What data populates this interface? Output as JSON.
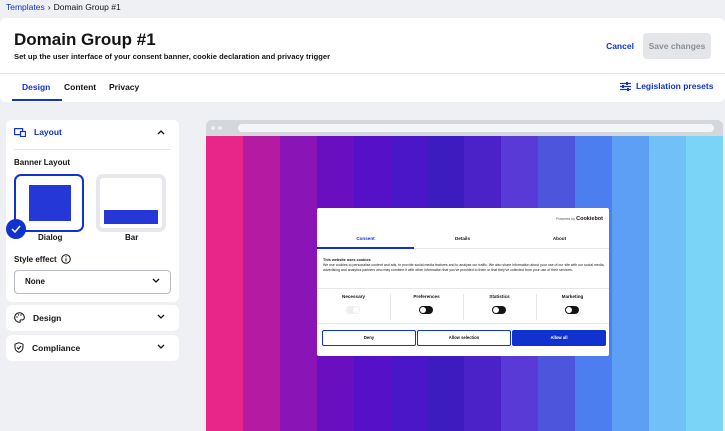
{
  "breadcrumb": {
    "parent": "Templates",
    "separator": "›",
    "current": "Domain Group #1"
  },
  "header": {
    "title": "Domain Group #1",
    "subtitle": "Set up the user interface of your consent banner, cookie declaration and privacy trigger",
    "cancel_label": "Cancel",
    "save_label": "Save changes"
  },
  "tabs": [
    {
      "label": "Design",
      "active": true
    },
    {
      "label": "Content",
      "active": false
    },
    {
      "label": "Privacy",
      "active": false
    }
  ],
  "legislation_label": "Legislation presets",
  "sidebar": {
    "layout": {
      "title": "Layout",
      "banner_layout_label": "Banner Layout",
      "options": [
        {
          "label": "Dialog",
          "selected": true
        },
        {
          "label": "Bar",
          "selected": false
        }
      ],
      "style_effect_label": "Style effect",
      "style_effect_value": "None"
    },
    "design_title": "Design",
    "compliance_title": "Compliance"
  },
  "preview": {
    "powered_by": "Powered by",
    "brand": "Cookiebot",
    "tabs": [
      "Consent",
      "Details",
      "About"
    ],
    "heading": "This website uses cookies",
    "description": "We use cookies to personalise content and ads, to provide social media features and to analyse our traffic. We also share information about your use of our site with our social media, advertising and analytics partners who may combine it with other information that you've provided to them or that they've collected from your use of their services.",
    "categories": [
      {
        "label": "Necessary",
        "state": "disabled"
      },
      {
        "label": "Preferences",
        "state": "off"
      },
      {
        "label": "Statistics",
        "state": "off"
      },
      {
        "label": "Marketing",
        "state": "off"
      }
    ],
    "buttons": {
      "deny": "Deny",
      "selection": "Allow selection",
      "all": "Allow all"
    }
  },
  "colors": {
    "accent": "#1032cf",
    "background_stripes": [
      "#e8268a",
      "#b51aa3",
      "#8a14b5",
      "#6a0fc0",
      "#5510c8",
      "#4a16c8",
      "#3c1bbf",
      "#4a22c8",
      "#5a3ad6",
      "#4e55dd",
      "#4d7ef0",
      "#5e9ff6",
      "#72c0f8",
      "#7ad4f8"
    ]
  }
}
